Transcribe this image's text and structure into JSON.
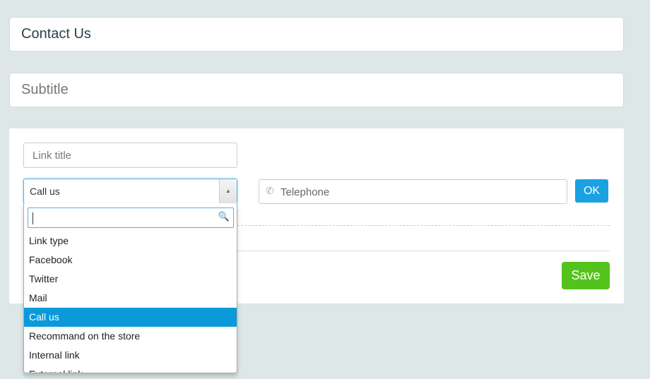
{
  "title": "Contact Us",
  "subtitle_placeholder": "Subtitle",
  "link_title_placeholder": "Link title",
  "select": {
    "value": "Call us",
    "arrow_glyph": "▲"
  },
  "telephone_placeholder": "Telephone",
  "ok_label": "OK",
  "save_label": "Save",
  "dropdown": {
    "options": [
      "Link type",
      "Facebook",
      "Twitter",
      "Mail",
      "Call us",
      "Recommand on the store",
      "Internal link",
      "External link"
    ],
    "selected_index": 4
  },
  "colors": {
    "accent": "#1aa1e1",
    "save": "#53c31b",
    "selected_option": "#0a9ad9",
    "background": "#dde7e7"
  }
}
